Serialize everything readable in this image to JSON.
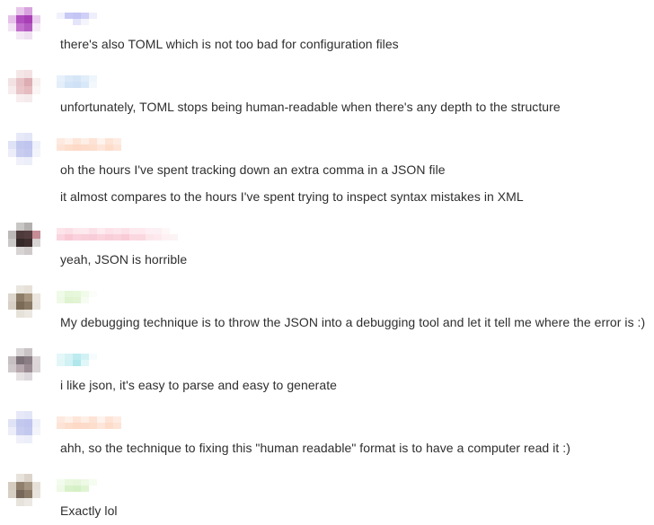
{
  "messages": [
    {
      "avatar": [
        "#ffffff",
        "#e7c7ea",
        "#d8a2df",
        "#ffffff",
        "#e6c2ea",
        "#b24fbf",
        "#a93fb7",
        "#ead0ee",
        "#f3e4f5",
        "#c26fcd",
        "#b45bc2",
        "#f6ecf7",
        "#ffffff",
        "#f4e8f6",
        "#efe0f1",
        "#ffffff"
      ],
      "name": [
        "#f1f1fd",
        "#ffffff",
        "#c9c9f6",
        "#ffffff",
        "#c4c4f5",
        "#e4e4fb",
        "#cfcff7",
        "#f4f4fd",
        "#eeeefc",
        "#ffffff"
      ],
      "lines": [
        "there's also TOML which is not too bad for configuration files"
      ]
    },
    {
      "avatar": [
        "#ffffff",
        "#f5e6e7",
        "#f3e1e3",
        "#ffffff",
        "#f3e2e4",
        "#e6c2c6",
        "#dcadb2",
        "#f8efef",
        "#f7eced",
        "#e9c6ca",
        "#e5bcc0",
        "#fbf5f5",
        "#ffffff",
        "#f8eeef",
        "#f6ebec",
        "#ffffff"
      ],
      "name": [
        "#e7f1fb",
        "#e3eefa",
        "#dbe9f8",
        "#d3e4f7",
        "#d6e6f7",
        "#cfe1f5",
        "#e1edf9",
        "#d9e8f8",
        "#eef5fc",
        "#f3f8fd"
      ],
      "lines": [
        "unfortunately, TOML stops being human-readable when there's any depth to the structure"
      ]
    },
    {
      "avatar": [
        "#ffffff",
        "#e7e9f8",
        "#e3e6f7",
        "#ffffff",
        "#e0e3f6",
        "#c3c8ef",
        "#bfc5ee",
        "#eef0fa",
        "#ecedf9",
        "#c8cdf0",
        "#c3c8ee",
        "#f3f4fb",
        "#ffffff",
        "#eff0fa",
        "#eceef9",
        "#ffffff"
      ],
      "name": [
        "#fde9df",
        "#fde3d6",
        "#fef1ea",
        "#fdddcc",
        "#fde5d8",
        "#fed9c6",
        "#fdeee6",
        "#fddbca",
        "#fde3d6",
        "#fdddcc",
        "#fef3ed",
        "#fde6d9",
        "#fde4d7",
        "#fddcca",
        "#feece3",
        "#fde4d7"
      ],
      "lines": [
        "oh the hours I've spent tracking down an extra comma in a JSON file",
        "it almost compares to the hours I've spent trying to inspect syntax mistakes in XML"
      ]
    },
    {
      "avatar": [
        "#ffffff",
        "#c9c6c6",
        "#b5b0b0",
        "#ffffff",
        "#bdb8b8",
        "#4e3a3a",
        "#553e3f",
        "#c58d96",
        "#cbc8c8",
        "#342828",
        "#3e2d2d",
        "#d7d3d3",
        "#ffffff",
        "#d8d4d4",
        "#cfcaca",
        "#ffffff"
      ],
      "name": [
        "#fde4ea",
        "#fad4de",
        "#fcdfe6",
        "#f8c9d5",
        "#fde8ed",
        "#fad1dc",
        "#fdeaef",
        "#f9cfd9",
        "#fce0e7",
        "#f8ccd8",
        "#fdebf0",
        "#fad3dd",
        "#fde2e9",
        "#f9ced8",
        "#fde6ec",
        "#fad2dc",
        "#fce1e8",
        "#f9cbd7",
        "#fdeaef",
        "#fbd8e1",
        "#fee9ef",
        "#fbd7e0",
        "#fdeff3",
        "#fce6ec",
        "#fbf0f3",
        "#fde9ee",
        "#fff6f8",
        "#fef1f4",
        "#ffffff",
        "#fcf3f5"
      ],
      "lines": [
        "yeah, JSON is horrible"
      ]
    },
    {
      "avatar": [
        "#ffffff",
        "#e9e5df",
        "#e6e0d8",
        "#ffffff",
        "#ddd6cc",
        "#8d7d68",
        "#a89680",
        "#eae5de",
        "#d8d0c5",
        "#7a6a56",
        "#8a7a65",
        "#e9e4dd",
        "#ffffff",
        "#e6e1d9",
        "#ebe7e1",
        "#ffffff"
      ],
      "name": [
        "#f0fae8",
        "#eff9e6",
        "#e5f6d9",
        "#dff3d0",
        "#e7f7dc",
        "#e2f4d4",
        "#f1fbe9",
        "#f6fcf1",
        "#fbfdf8",
        "#ffffff"
      ],
      "lines": [
        "My debugging technique is to throw the JSON into a debugging tool and let it tell me where the error is :)"
      ]
    },
    {
      "avatar": [
        "#ffffff",
        "#dad6d8",
        "#c9c3c6",
        "#ffffff",
        "#c6c0c3",
        "#7d7277",
        "#8a7e84",
        "#dcd6d9",
        "#d0c9cc",
        "#b6a8ae",
        "#9b8c93",
        "#dbd5d8",
        "#ffffff",
        "#e6e2e4",
        "#ddd8db",
        "#ffffff"
      ],
      "name": [
        "#e4f7f9",
        "#e2f6f8",
        "#d6f2f5",
        "#d1f1f4",
        "#bdebef",
        "#b0e7ec",
        "#d2f1f5",
        "#e0f6f8",
        "#f6fcfd",
        "#ffffff"
      ],
      "lines": [
        "i like json, it's easy to parse and easy to generate"
      ]
    },
    {
      "avatar": [
        "#ffffff",
        "#e7e9f8",
        "#e3e6f7",
        "#ffffff",
        "#e0e3f6",
        "#c3c8ef",
        "#bfc5ee",
        "#eef0fa",
        "#ecedf9",
        "#c8cdf0",
        "#c3c8ee",
        "#f3f4fb",
        "#ffffff",
        "#eff0fa",
        "#eceef9",
        "#ffffff"
      ],
      "name": [
        "#fde9df",
        "#fde3d6",
        "#fef1ea",
        "#fdddcc",
        "#fde5d8",
        "#fed9c6",
        "#fdeee6",
        "#fddbca",
        "#fde3d6",
        "#fdddcc",
        "#fef3ed",
        "#fde6d9",
        "#fde4d7",
        "#fddcca",
        "#feece3",
        "#fde4d7"
      ],
      "lines": [
        "ahh, so the technique to fixing this \"human readable\" format is to have a computer read it :)"
      ]
    },
    {
      "avatar": [
        "#ffffff",
        "#e7e2dc",
        "#dcd4ca",
        "#ffffff",
        "#d5ccc0",
        "#8f7f6c",
        "#a59683",
        "#e6e0d9",
        "#d8cfc4",
        "#76675a",
        "#8a7b69",
        "#e8e3dc",
        "#ffffff",
        "#e7e2dc",
        "#ece8e3",
        "#ffffff"
      ],
      "name": [
        "#f3fbee",
        "#eef9e6",
        "#e9f7df",
        "#d9f1cb",
        "#e6f6db",
        "#d6f0c6",
        "#eef9e6",
        "#dff4d3",
        "#f5fcf0",
        "#ffffff"
      ],
      "lines": [
        "Exactly lol"
      ]
    }
  ]
}
